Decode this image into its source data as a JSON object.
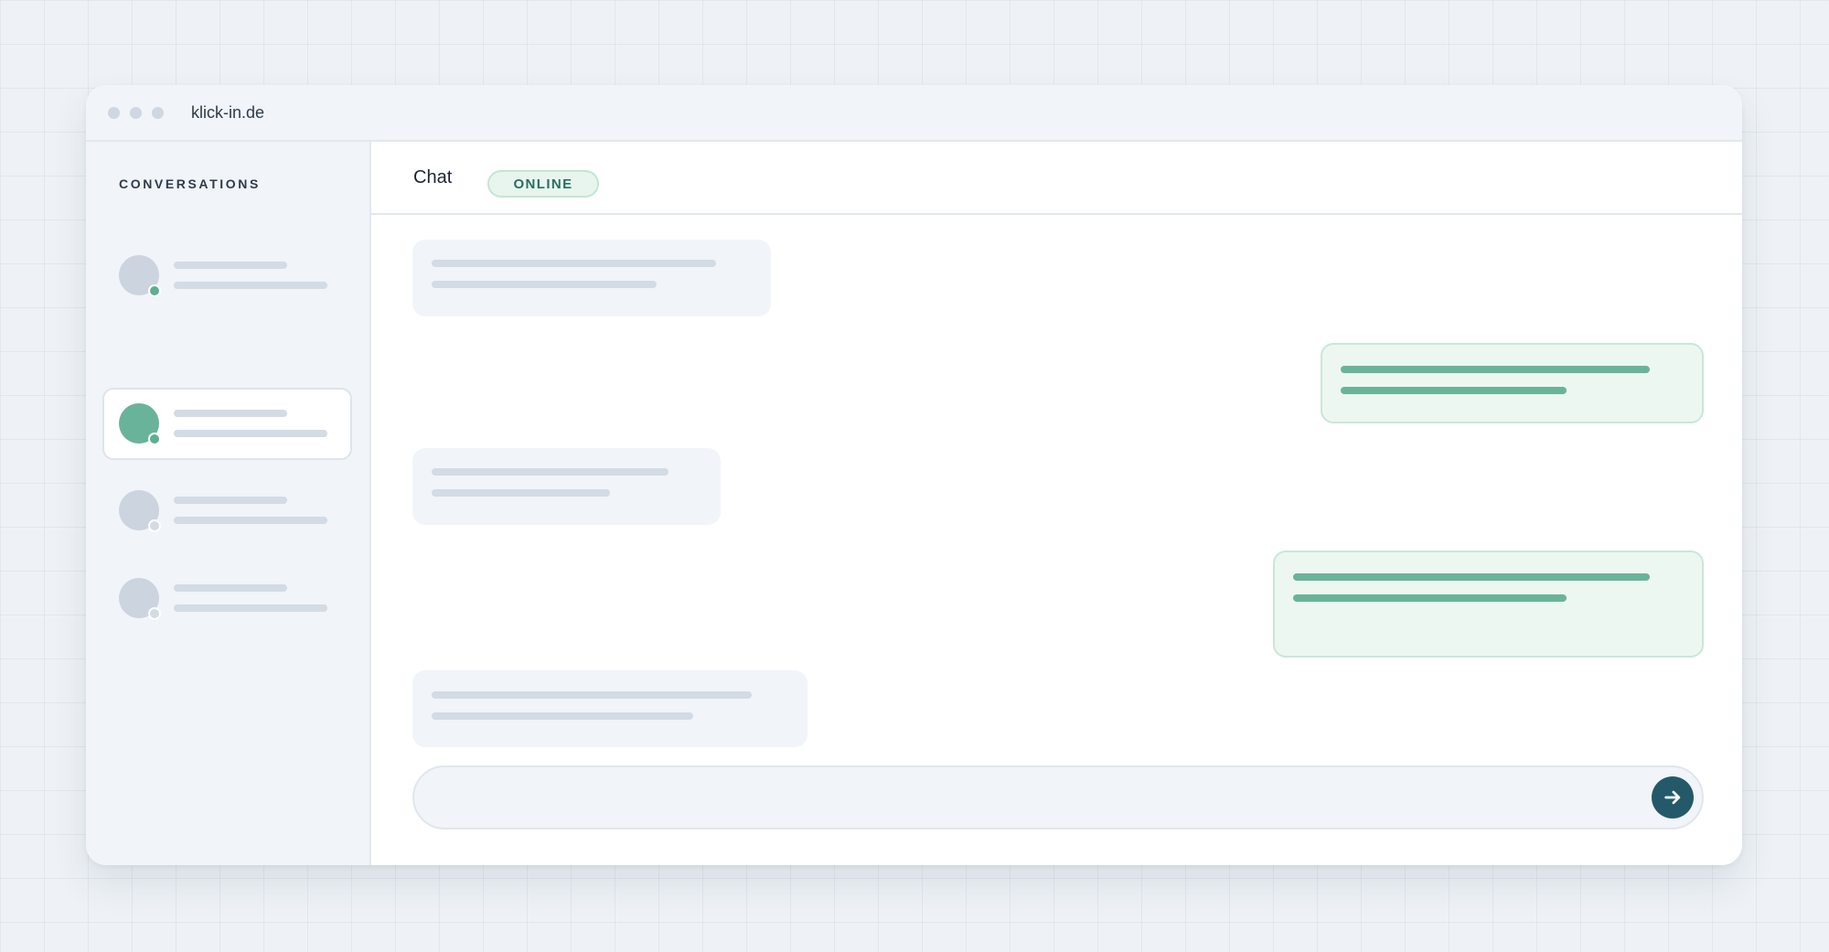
{
  "window": {
    "url": "klick-in.de"
  },
  "sidebar": {
    "title": "CONVERSATIONS",
    "conversations": [
      {
        "active": false,
        "avatar_color": "#cbd4df",
        "status": "online",
        "status_color": "#5fae92"
      },
      {
        "active": true,
        "avatar_color": "#6ab39b",
        "status": "online",
        "status_color": "#5fae92"
      },
      {
        "active": false,
        "avatar_color": "#cbd4df",
        "status": "offline",
        "status_color": "#d3dbe5"
      },
      {
        "active": false,
        "avatar_color": "#cbd4df",
        "status": "offline",
        "status_color": "#d3dbe5"
      }
    ]
  },
  "header": {
    "title": "Chat",
    "status_badge": "ONLINE"
  },
  "messages": [
    {
      "direction": "incoming"
    },
    {
      "direction": "outgoing"
    },
    {
      "direction": "incoming"
    },
    {
      "direction": "outgoing"
    },
    {
      "direction": "incoming"
    }
  ],
  "composer": {
    "send_icon": "arrow-right-icon"
  },
  "colors": {
    "accent": "#6ab39b",
    "send_button": "#24596a",
    "badge_text": "#2c6e60",
    "skeleton": "#d3dbe5",
    "panel": "#f1f4f8"
  }
}
